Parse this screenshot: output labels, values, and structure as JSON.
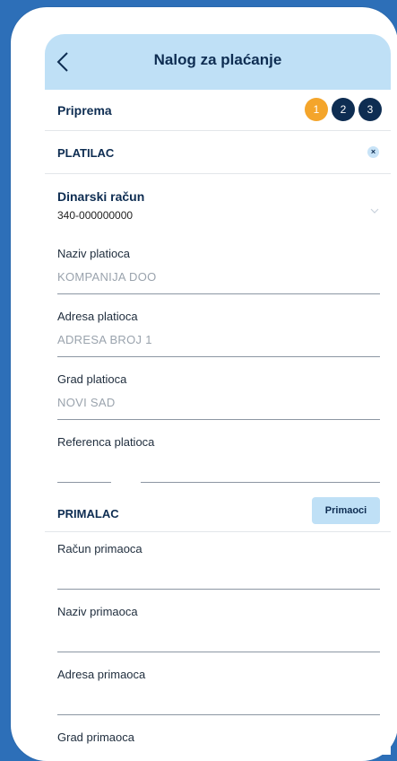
{
  "header": {
    "title": "Nalog za plaćanje"
  },
  "stepbar": {
    "label": "Priprema",
    "steps": [
      "1",
      "2",
      "3"
    ]
  },
  "payer": {
    "section_title": "PLATILAC",
    "close_glyph": "×",
    "account_label": "Dinarski račun",
    "account_number": "340-000000000",
    "fields": [
      {
        "label": "Naziv platioca",
        "value": "KOMPANIJA DOO"
      },
      {
        "label": "Adresa platioca",
        "value": "ADRESA BROJ 1"
      },
      {
        "label": "Grad platioca",
        "value": "NOVI SAD"
      },
      {
        "label": "Referenca platioca",
        "value": ""
      }
    ]
  },
  "recipient": {
    "section_title": "PRIMALAC",
    "button_label": "Primaoci",
    "fields": [
      {
        "label": "Račun primaoca",
        "value": ""
      },
      {
        "label": "Naziv primaoca",
        "value": ""
      },
      {
        "label": "Adresa primaoca",
        "value": ""
      },
      {
        "label": "Grad primaoca",
        "value": ""
      }
    ]
  },
  "colors": {
    "accent": "#f4a52b",
    "navy": "#0e2d52",
    "header_bg": "#bfe0f6",
    "background": "#2d6fb8"
  }
}
